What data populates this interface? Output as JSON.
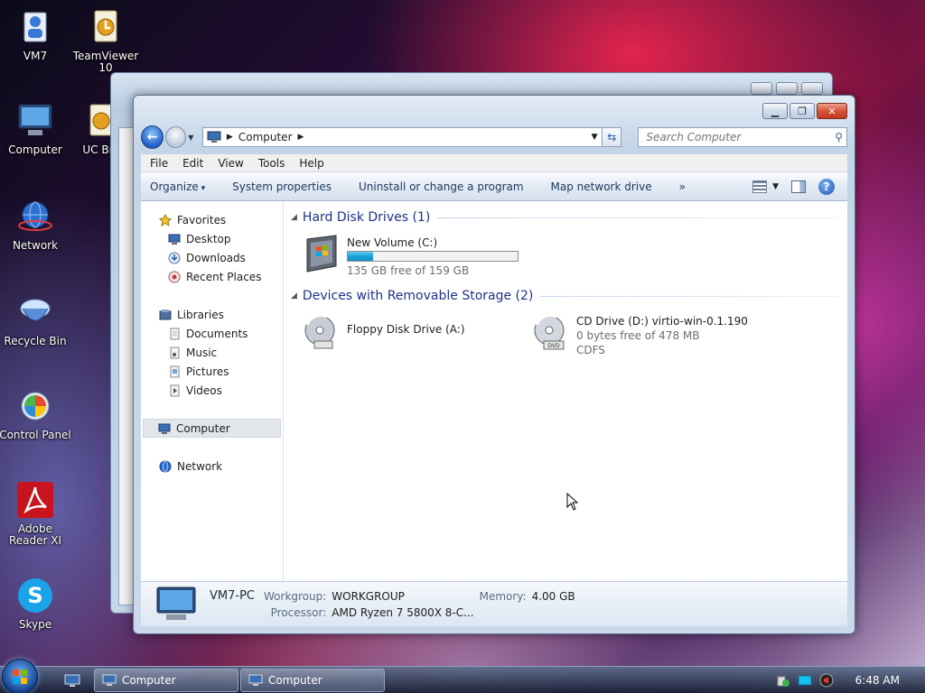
{
  "desktop": {
    "icons": [
      {
        "label": "VM7"
      },
      {
        "label": "TeamViewer 10"
      },
      {
        "label": "Computer"
      },
      {
        "label": "UC Bro"
      },
      {
        "label": "Network"
      },
      {
        "label": "Recycle Bin"
      },
      {
        "label": "Control Panel"
      },
      {
        "label": "Adobe Reader XI"
      },
      {
        "label": "Skype"
      }
    ]
  },
  "window": {
    "address": {
      "segment": "Computer"
    },
    "search": {
      "placeholder": "Search Computer"
    },
    "menu": [
      "File",
      "Edit",
      "View",
      "Tools",
      "Help"
    ],
    "toolbar": {
      "organize": "Organize",
      "system_properties": "System properties",
      "uninstall": "Uninstall or change a program",
      "map_drive": "Map network drive",
      "more": "»"
    },
    "navpane": {
      "favorites": "Favorites",
      "favorites_items": [
        "Desktop",
        "Downloads",
        "Recent Places"
      ],
      "libraries": "Libraries",
      "libraries_items": [
        "Documents",
        "Music",
        "Pictures",
        "Videos"
      ],
      "computer": "Computer",
      "network": "Network"
    },
    "groups": {
      "hdd": {
        "title": "Hard Disk Drives (1)",
        "drives": [
          {
            "name": "New Volume (C:)",
            "free": "135 GB free of 159 GB",
            "used_fraction": 0.15
          }
        ]
      },
      "removable": {
        "title": "Devices with Removable Storage (2)",
        "floppy": {
          "name": "Floppy Disk Drive (A:)"
        },
        "cd": {
          "name": "CD Drive (D:) virtio-win-0.1.190",
          "free": "0 bytes free of 478 MB",
          "fs": "CDFS"
        }
      }
    },
    "details": {
      "pc_name": "VM7-PC",
      "workgroup_label": "Workgroup:",
      "workgroup": "WORKGROUP",
      "memory_label": "Memory:",
      "memory": "4.00 GB",
      "processor_label": "Processor:",
      "processor": "AMD Ryzen 7 5800X 8-C..."
    }
  },
  "taskbar": {
    "buttons": [
      "Computer",
      "Computer"
    ],
    "clock": "6:48 AM"
  }
}
